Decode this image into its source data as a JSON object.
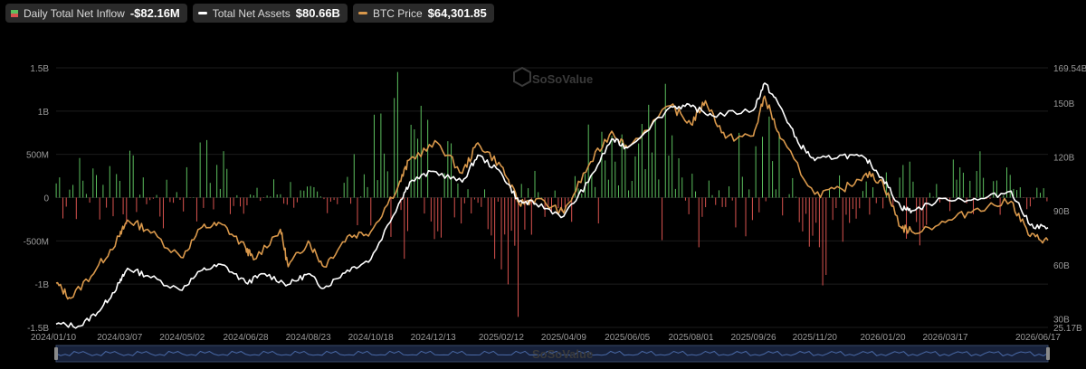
{
  "legend": {
    "inflow": {
      "label": "Daily Total Net Inflow",
      "value": "-$82.16M",
      "color": "#5cbf5e"
    },
    "assets": {
      "label": "Total Net Assets",
      "value": "$80.66B",
      "color": "#ffffff"
    },
    "btc": {
      "label": "BTC Price",
      "value": "$64,301.85",
      "color": "#d9984b"
    }
  },
  "watermark": "SoSoValue",
  "navigator_watermark": "SoSoValue",
  "chart_data": {
    "type": "bar",
    "colors": {
      "positive": "#5cbf5e",
      "negative": "#d9534f",
      "assets_line": "#ffffff",
      "price_line": "#d9984b"
    },
    "x_axis": {
      "start": "2024/01/10",
      "end": "2026/06/17",
      "ticks": [
        "2024/01/10",
        "2024/03/07",
        "2024/05/02",
        "2024/06/28",
        "2024/08/23",
        "2024/10/18",
        "2024/12/13",
        "2025/02/12",
        "2025/04/09",
        "2025/06/05",
        "2025/08/01",
        "2025/09/26",
        "2025/11/20",
        "2026/01/20",
        "2026/03/17",
        "2026/06/17"
      ]
    },
    "y_left": {
      "ticks": [
        "1.5B",
        "1B",
        "500M",
        "0",
        "-500M",
        "-1B",
        "-1.5B"
      ],
      "min": -1500,
      "max": 1500,
      "unit": "M"
    },
    "y_right": {
      "ticks": [
        "169.54B",
        "150B",
        "120B",
        "90B",
        "60B",
        "30B",
        "25.17B"
      ],
      "min": 25.17,
      "max": 169.54,
      "unit": "B"
    },
    "grid": true,
    "legend_position": "top-left",
    "series": [
      {
        "name": "Daily Total Net Inflow",
        "kind": "bar",
        "unit": "M USD",
        "anchors": [
          [
            "2024/01/10",
            500
          ],
          [
            "2024/02/10",
            300
          ],
          [
            "2024/03/07",
            600
          ],
          [
            "2024/04/15",
            -300
          ],
          [
            "2024/05/02",
            300
          ],
          [
            "2024/06/05",
            700
          ],
          [
            "2024/06/28",
            -150
          ],
          [
            "2024/08/01",
            250
          ],
          [
            "2024/09/01",
            -200
          ],
          [
            "2024/10/18",
            600
          ],
          [
            "2024/11/10",
            1300
          ],
          [
            "2024/12/13",
            800
          ],
          [
            "2025/01/10",
            400
          ],
          [
            "2025/02/25",
            -1100
          ],
          [
            "2025/03/20",
            -300
          ],
          [
            "2025/04/09",
            200
          ],
          [
            "2025/05/01",
            700
          ],
          [
            "2025/06/05",
            500
          ],
          [
            "2025/07/15",
            1100
          ],
          [
            "2025/08/01",
            -600
          ],
          [
            "2025/09/26",
            900
          ],
          [
            "2025/10/20",
            700
          ],
          [
            "2025/11/20",
            -900
          ],
          [
            "2025/12/20",
            -300
          ],
          [
            "2026/01/20",
            500
          ],
          [
            "2026/02/10",
            -800
          ],
          [
            "2026/03/17",
            300
          ],
          [
            "2026/05/01",
            400
          ],
          [
            "2026/06/17",
            -82.16
          ]
        ]
      },
      {
        "name": "Total Net Assets",
        "kind": "line",
        "unit": "B USD",
        "points": [
          [
            "2024/01/10",
            27
          ],
          [
            "2024/02/01",
            26
          ],
          [
            "2024/02/20",
            36
          ],
          [
            "2024/03/07",
            50
          ],
          [
            "2024/03/14",
            58
          ],
          [
            "2024/04/01",
            54
          ],
          [
            "2024/04/30",
            46
          ],
          [
            "2024/05/20",
            57
          ],
          [
            "2024/06/07",
            60
          ],
          [
            "2024/06/28",
            50
          ],
          [
            "2024/07/15",
            55
          ],
          [
            "2024/08/05",
            49
          ],
          [
            "2024/08/23",
            55
          ],
          [
            "2024/09/06",
            47
          ],
          [
            "2024/09/27",
            57
          ],
          [
            "2024/10/18",
            63
          ],
          [
            "2024/11/12",
            94
          ],
          [
            "2024/11/22",
            106
          ],
          [
            "2024/12/13",
            112
          ],
          [
            "2025/01/08",
            106
          ],
          [
            "2025/01/22",
            121
          ],
          [
            "2025/02/12",
            111
          ],
          [
            "2025/02/28",
            95
          ],
          [
            "2025/03/15",
            94
          ],
          [
            "2025/04/09",
            87
          ],
          [
            "2025/05/01",
            106
          ],
          [
            "2025/05/22",
            130
          ],
          [
            "2025/06/05",
            125
          ],
          [
            "2025/07/14",
            148
          ],
          [
            "2025/08/01",
            148
          ],
          [
            "2025/08/20",
            143
          ],
          [
            "2025/09/26",
            146
          ],
          [
            "2025/10/06",
            161
          ],
          [
            "2025/10/20",
            148
          ],
          [
            "2025/11/05",
            128
          ],
          [
            "2025/11/20",
            118
          ],
          [
            "2025/12/15",
            121
          ],
          [
            "2026/01/05",
            119
          ],
          [
            "2026/01/20",
            108
          ],
          [
            "2026/02/05",
            92
          ],
          [
            "2026/02/15",
            90
          ],
          [
            "2026/03/17",
            97
          ],
          [
            "2026/04/15",
            96
          ],
          [
            "2026/05/15",
            101
          ],
          [
            "2026/06/01",
            82
          ],
          [
            "2026/06/17",
            80.66
          ]
        ]
      },
      {
        "name": "BTC Price",
        "kind": "line",
        "unit": "USD",
        "points": [
          [
            "2024/01/10",
            46000
          ],
          [
            "2024/01/23",
            39500
          ],
          [
            "2024/02/15",
            52000
          ],
          [
            "2024/03/07",
            66000
          ],
          [
            "2024/03/14",
            73000
          ],
          [
            "2024/04/01",
            69000
          ],
          [
            "2024/05/01",
            57000
          ],
          [
            "2024/05/20",
            70000
          ],
          [
            "2024/06/07",
            71000
          ],
          [
            "2024/06/28",
            61000
          ],
          [
            "2024/07/05",
            56000
          ],
          [
            "2024/07/29",
            69000
          ],
          [
            "2024/08/05",
            53000
          ],
          [
            "2024/08/23",
            64000
          ],
          [
            "2024/09/06",
            53000
          ],
          [
            "2024/09/27",
            66000
          ],
          [
            "2024/10/18",
            68000
          ],
          [
            "2024/11/12",
            88000
          ],
          [
            "2024/11/22",
            99000
          ],
          [
            "2024/12/17",
            106000
          ],
          [
            "2025/01/08",
            93000
          ],
          [
            "2025/01/22",
            106000
          ],
          [
            "2025/02/12",
            96000
          ],
          [
            "2025/02/28",
            80000
          ],
          [
            "2025/03/15",
            82000
          ],
          [
            "2025/04/09",
            76000
          ],
          [
            "2025/05/01",
            96000
          ],
          [
            "2025/05/22",
            111000
          ],
          [
            "2025/06/05",
            104000
          ],
          [
            "2025/07/14",
            122000
          ],
          [
            "2025/08/01",
            114000
          ],
          [
            "2025/08/14",
            124000
          ],
          [
            "2025/09/01",
            108000
          ],
          [
            "2025/09/26",
            109000
          ],
          [
            "2025/10/06",
            126000
          ],
          [
            "2025/10/20",
            108000
          ],
          [
            "2025/11/20",
            84000
          ],
          [
            "2025/12/15",
            86000
          ],
          [
            "2026/01/05",
            93000
          ],
          [
            "2026/01/20",
            89000
          ],
          [
            "2026/02/05",
            70000
          ],
          [
            "2026/02/15",
            68000
          ],
          [
            "2026/03/17",
            72000
          ],
          [
            "2026/04/15",
            78000
          ],
          [
            "2026/05/15",
            81000
          ],
          [
            "2026/06/01",
            66000
          ],
          [
            "2026/06/17",
            64301.85
          ]
        ]
      }
    ]
  }
}
